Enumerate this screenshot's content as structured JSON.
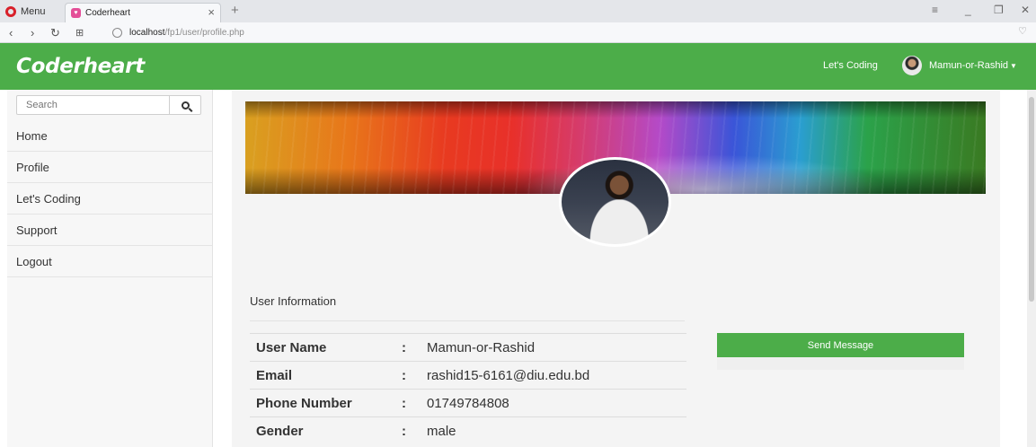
{
  "browser": {
    "menu_label": "Menu",
    "tab_title": "Coderheart",
    "tab_close": "×",
    "new_tab": "+",
    "url_host": "localhost",
    "url_path": "/fp1/user/profile.php"
  },
  "header": {
    "brand": "Coderheart",
    "nav_link": "Let's Coding",
    "user_name": "Mamun-or-Rashid"
  },
  "sidebar": {
    "search_placeholder": "Search",
    "items": [
      {
        "label": "Home"
      },
      {
        "label": "Profile"
      },
      {
        "label": "Let's Coding"
      },
      {
        "label": "Support"
      },
      {
        "label": "Logout"
      }
    ]
  },
  "profile": {
    "section_title": "User Information",
    "separator": ":",
    "fields": [
      {
        "label": "User Name",
        "value": "Mamun-or-Rashid"
      },
      {
        "label": "Email",
        "value": "rashid15-6161@diu.edu.bd"
      },
      {
        "label": "Phone Number",
        "value": "01749784808"
      },
      {
        "label": "Gender",
        "value": "male"
      }
    ],
    "send_button": "Send Message"
  },
  "colors": {
    "brand_green": "#4cad49",
    "sidebar_bg": "#f7f7f7",
    "card_bg": "#f4f4f4"
  }
}
